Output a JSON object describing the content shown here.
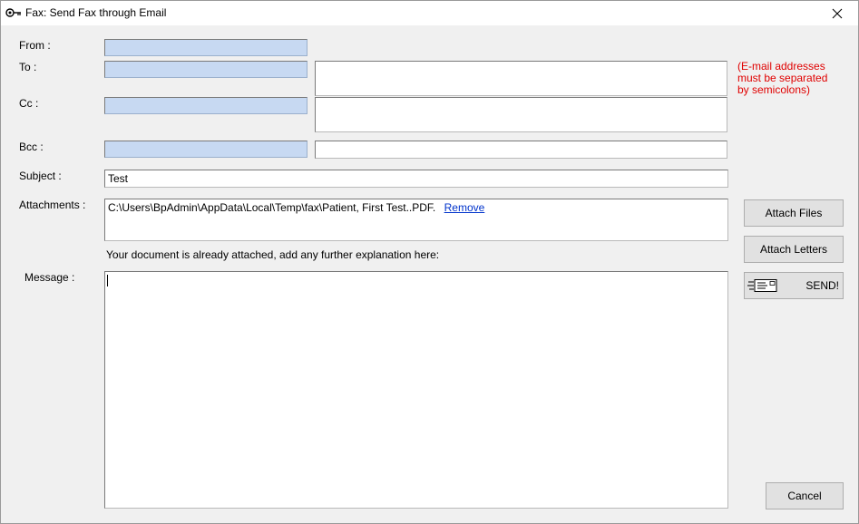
{
  "window": {
    "title": "Fax: Send Fax through Email",
    "close_label": "✕"
  },
  "form": {
    "from_label": "From :",
    "to_label": "To :",
    "cc_label": "Cc :",
    "bcc_label": "Bcc :",
    "subject_label": "Subject :",
    "attachments_label": "Attachments :",
    "message_label": "Message :",
    "subject_value": "Test",
    "separator_hint": "(E-mail addresses must be separated by semicolons)",
    "attachment_path": "C:\\Users\\BpAdmin\\AppData\\Local\\Temp\\fax\\Patient, First Test..PDF.",
    "remove_link": "Remove",
    "instruction": "Your document is already attached, add any further explanation here:",
    "message_value": ""
  },
  "buttons": {
    "attach_files": "Attach Files",
    "attach_letters": "Attach Letters",
    "send": "SEND!",
    "cancel": "Cancel"
  },
  "colors": {
    "address_box": "#c7d9f2",
    "hint_text": "#e00000",
    "link": "#0033cc"
  },
  "icons": {
    "title_icon": "fax-key-icon",
    "send_icon": "envelope-send-icon"
  }
}
